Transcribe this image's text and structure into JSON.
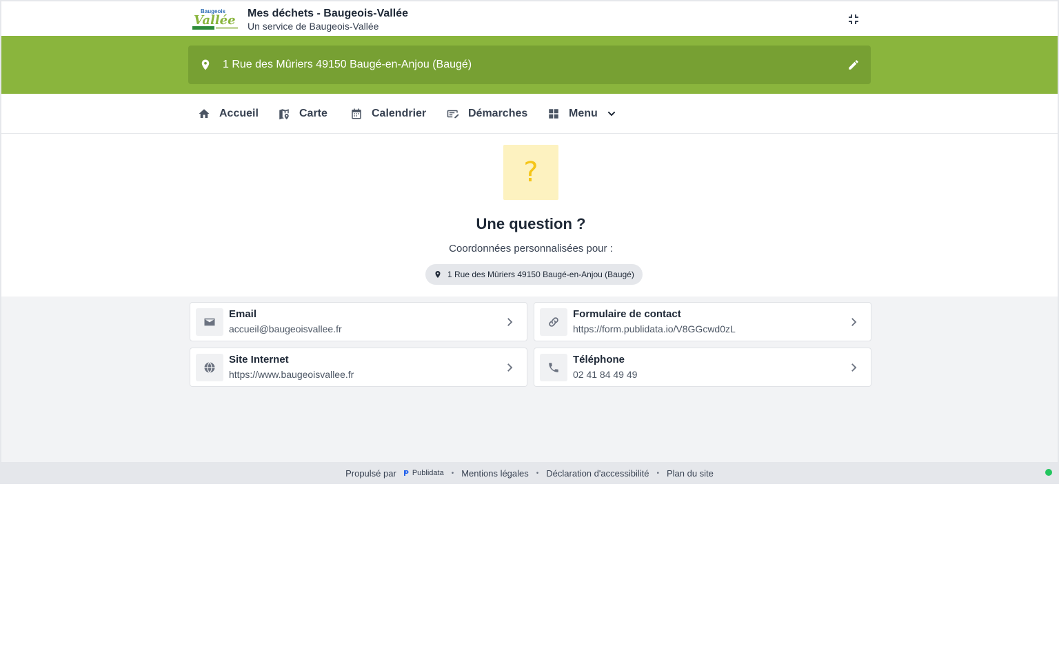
{
  "header": {
    "title": "Mes déchets - Baugeois-Vallée",
    "subtitle": "Un service de Baugeois-Vallée",
    "logo_text_top": "Baugeois",
    "logo_text_main": "Vallée"
  },
  "address": {
    "value": "1 Rue des Mûriers 49150 Baugé-en-Anjou (Baugé)"
  },
  "nav": {
    "items": [
      {
        "label": "Accueil",
        "icon": "home-icon"
      },
      {
        "label": "Carte",
        "icon": "map-icon"
      },
      {
        "label": "Calendrier",
        "icon": "calendar-icon"
      },
      {
        "label": "Démarches",
        "icon": "form-edit-icon"
      },
      {
        "label": "Menu",
        "icon": "grid-icon"
      }
    ]
  },
  "hero": {
    "icon": "?",
    "title": "Une question ?",
    "subtitle": "Coordonnées personnalisées pour :",
    "chip": "1 Rue des Mûriers 49150 Baugé-en-Anjou (Baugé)"
  },
  "contacts": [
    {
      "title": "Email",
      "value": "accueil@baugeoisvallee.fr",
      "icon": "mail-icon"
    },
    {
      "title": "Formulaire de contact",
      "value": "https://form.publidata.io/V8GGcwd0zL",
      "icon": "link-icon"
    },
    {
      "title": "Site Internet",
      "value": "https://www.baugeoisvallee.fr",
      "icon": "globe-icon"
    },
    {
      "title": "Téléphone",
      "value": "02 41 84 49 49",
      "icon": "phone-icon"
    }
  ],
  "footer": {
    "powered_by": "Propulsé par",
    "brand": "Publidata",
    "links": [
      "Mentions légales",
      "Déclaration d'accessibilité",
      "Plan du site"
    ]
  },
  "colors": {
    "brand_green": "#8ab53d",
    "address_bar": "#77a033",
    "question_bg": "#fdf2c0",
    "question_fg": "#f5c518",
    "status_ok": "#22c55e"
  }
}
